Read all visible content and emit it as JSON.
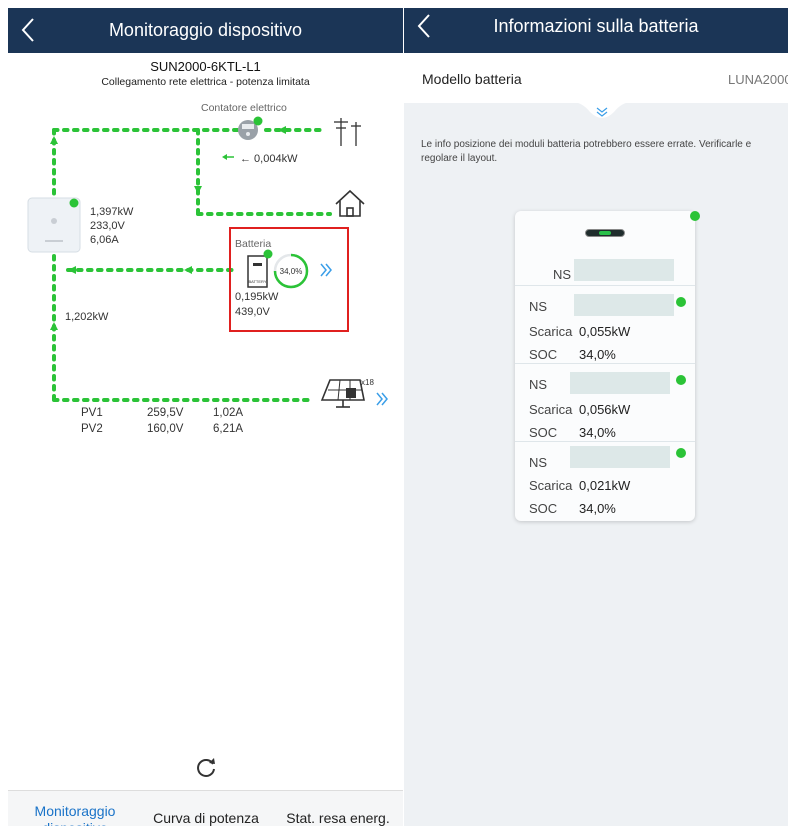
{
  "left": {
    "title": "Monitoraggio dispositivo",
    "device_name": "SUN2000-6KTL-L1",
    "grid_mode": "Collegamento rete elettrica - potenza limitata",
    "meter_label": "Contatore elettrico",
    "meter_power": "← 0,004kW",
    "inverter": {
      "power": "1,397kW",
      "voltage": "233,0V",
      "current": "6,06A"
    },
    "pv_line_power": "1,202kW",
    "battery": {
      "label": "Batteria",
      "soc": "34,0%",
      "power": "0,195kW",
      "voltage": "439,0V"
    },
    "pv_count": "x18",
    "pv": [
      {
        "name": "PV1",
        "voltage": "259,5V",
        "current": "1,02A"
      },
      {
        "name": "PV2",
        "voltage": "160,0V",
        "current": "6,21A"
      }
    ],
    "tabs": [
      "Monitoraggio dispositivo",
      "Curva di potenza",
      "Stat. resa energ."
    ],
    "active_tab": 0
  },
  "right": {
    "title": "Informazioni sulla batteria",
    "model_label": "Modello batteria",
    "model_value": "LUNA2000",
    "notice": "Le info posizione dei moduli batteria potrebbero essere errate. Verificarle e regolare il layout.",
    "card_ns_label": "NS",
    "modules": [
      {
        "ns": "NS",
        "discharge_label": "Scarica",
        "discharge": "0,055kW",
        "soc_label": "SOC",
        "soc": "34,0%"
      },
      {
        "ns": "NS",
        "discharge_label": "Scarica",
        "discharge": "0,056kW",
        "soc_label": "SOC",
        "soc": "34,0%"
      },
      {
        "ns": "NS",
        "discharge_label": "Scarica",
        "discharge": "0,021kW",
        "soc_label": "SOC",
        "soc": "34,0%"
      }
    ]
  },
  "colors": {
    "header": "#1b3556",
    "flow_green": "#2bc337",
    "highlight_red": "#e0201f",
    "accent_blue": "#1a73c8",
    "chevron_blue": "#3a9ee8"
  },
  "icons": [
    "back-chevron-icon",
    "meter-icon",
    "power-tower-icon",
    "home-icon",
    "inverter-icon",
    "battery-icon",
    "solar-panel-icon",
    "double-chevron-right-icon",
    "refresh-icon",
    "double-chevron-down-icon"
  ]
}
